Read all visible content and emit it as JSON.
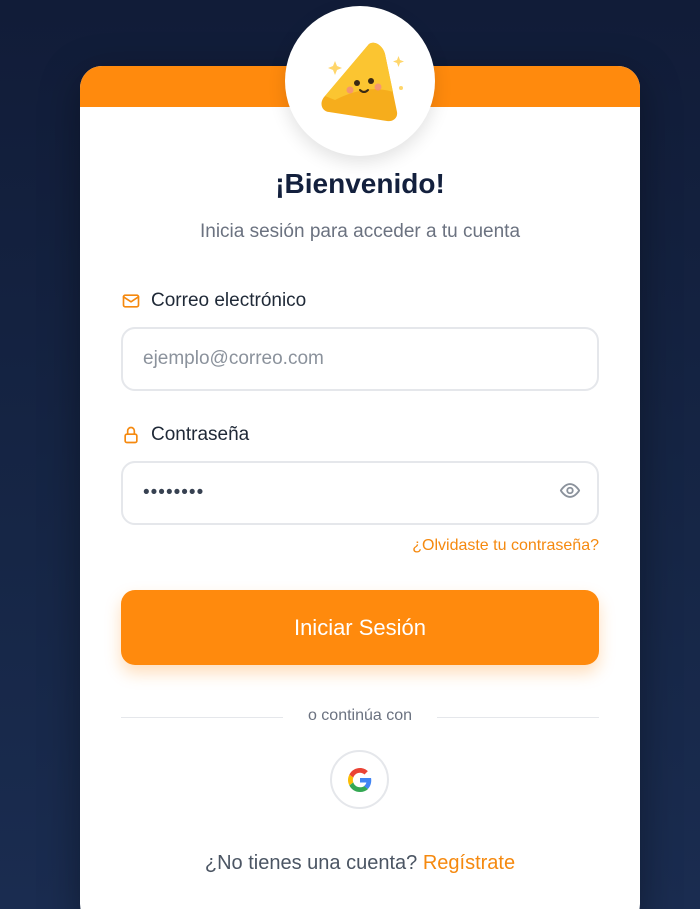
{
  "login": {
    "title": "¡Bienvenido!",
    "subtitle": "Inicia sesión para acceder a tu cuenta",
    "email_label": "Correo electrónico",
    "email_placeholder": "ejemplo@correo.com",
    "email_value": "",
    "password_label": "Contraseña",
    "password_value": "password",
    "forgot_link": "¿Olvidaste tu contraseña?",
    "submit_label": "Iniciar Sesión",
    "divider_text": "o continúa con",
    "no_account_text": "¿No tienes una cuenta?",
    "register_link": "Regístrate"
  },
  "colors": {
    "accent": "#ff8a0d",
    "background": "#13203d",
    "title": "#13203d"
  },
  "icons": {
    "avatar": "cheese-mascot-icon",
    "email": "mail-icon",
    "password": "lock-icon",
    "toggle_password": "eye-icon",
    "social": "google-icon"
  }
}
